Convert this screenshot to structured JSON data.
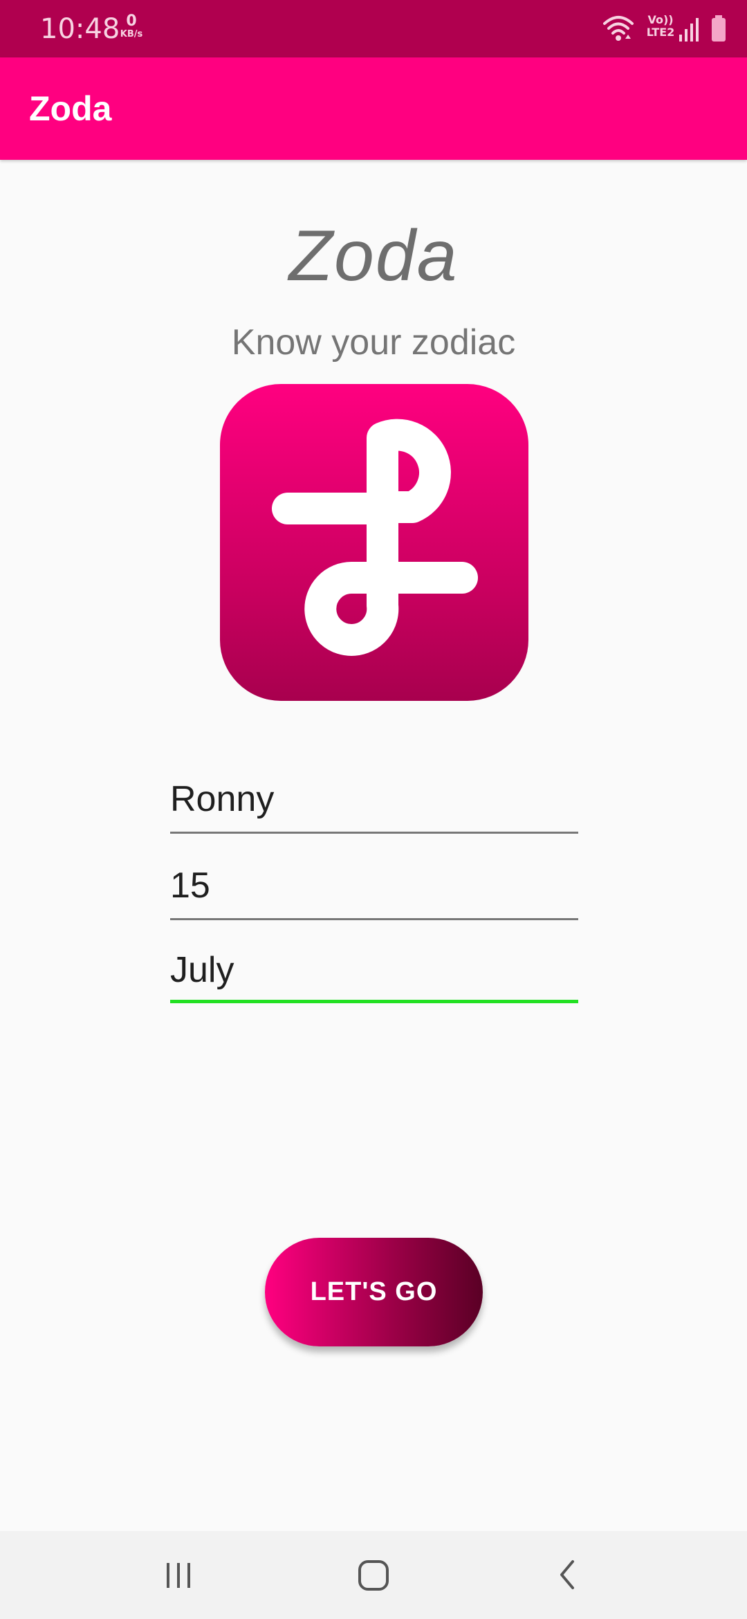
{
  "status_bar": {
    "time": "10:48",
    "net_speed_value": "0",
    "net_speed_unit": "KB/s",
    "lte_label_top": "Vo))",
    "lte_label_bottom": "LTE2",
    "background": "#b0004f"
  },
  "app_bar": {
    "title": "Zoda",
    "background": "#ff0080"
  },
  "main": {
    "brand_title": "Zoda",
    "tagline": "Know your zodiac",
    "logo_icon": "zoda-loop-logo-icon",
    "fields": {
      "name": {
        "value": "Ronny"
      },
      "day": {
        "value": "15"
      },
      "month": {
        "value": "July"
      }
    },
    "active_underline_color": "#22e022",
    "button_label": "LET'S GO"
  },
  "nav_bar": {
    "icons": [
      "recent-apps-icon",
      "home-icon",
      "back-icon"
    ]
  }
}
